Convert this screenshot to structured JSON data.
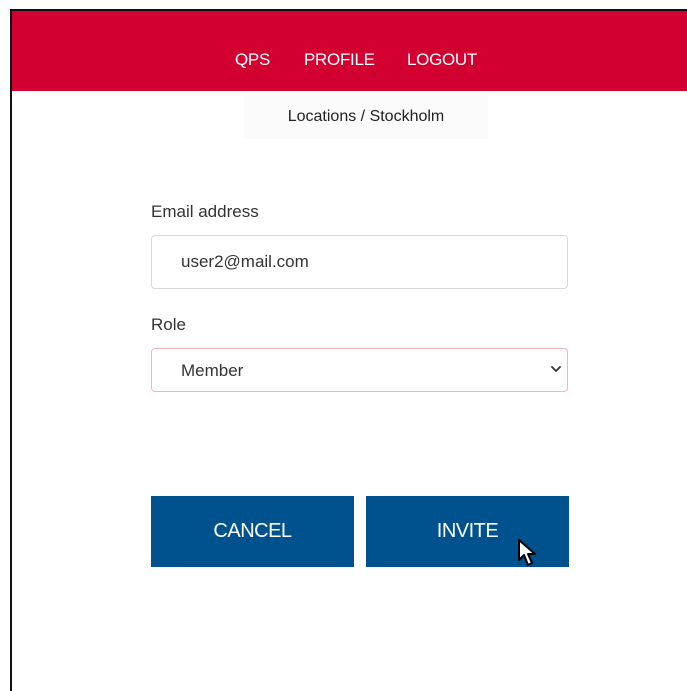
{
  "nav": {
    "items": [
      {
        "label": "QPS"
      },
      {
        "label": "PROFILE"
      },
      {
        "label": "LOGOUT"
      }
    ],
    "bar_color": "#d20030"
  },
  "breadcrumb": {
    "text": "Locations / Stockholm"
  },
  "form": {
    "email_label": "Email address",
    "email_value": "user2@mail.com",
    "role_label": "Role",
    "role_value": "Member"
  },
  "buttons": {
    "cancel_label": "CANCEL",
    "invite_label": "INVITE",
    "color": "#00528f"
  },
  "icons": {
    "dropdown": "chevron-down-icon",
    "pointer": "mouse-cursor-icon"
  }
}
